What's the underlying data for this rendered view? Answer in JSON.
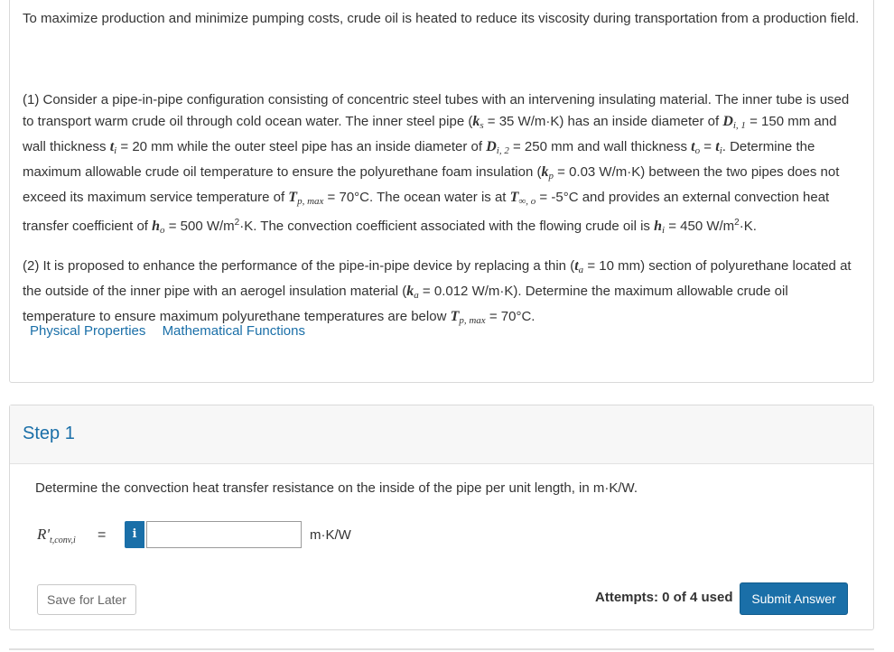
{
  "problem": {
    "intro": "To maximize production and minimize pumping costs, crude oil is heated to reduce its viscosity during transportation from a production field.",
    "part1": {
      "t1": "(1) Consider a pipe-in-pipe configuration consisting of concentric steel tubes with an intervening insulating material. The inner tube is used to transport warm crude oil through cold ocean water. The inner steel pipe (",
      "ks": "k",
      "ks_sub": "s",
      "t2": " = 35 W/m·K) has an inside diameter of ",
      "di1": "D",
      "di1_sub": "i, 1",
      "t3": " = 150 mm and wall thickness ",
      "ti": "t",
      "ti_sub": "i",
      "t4": " = 20 mm while the outer steel pipe has an inside diameter of ",
      "di2": "D",
      "di2_sub": "i, 2",
      "t5": " = 250 mm and wall thickness ",
      "to": "t",
      "to_sub": "o",
      "t6": " = ",
      "ti2": "t",
      "ti2_sub": "i",
      "t7": ". Determine the maximum allowable crude oil temperature to ensure the polyurethane foam insulation (",
      "kp": "k",
      "kp_sub": "p",
      "t8": " = 0.03 W/m·K) between the two pipes does not exceed its maximum service temperature of ",
      "tpmax": "T",
      "tpmax_sub": "p, max",
      "t9": " = 70°C. The ocean water is at ",
      "tinf": "T",
      "tinf_sub": "∞, o",
      "t10": " = -5°C and provides an external convection heat transfer coefficient of ",
      "ho": "h",
      "ho_sub": "o",
      "t11": " = 500 W/m",
      "t11_sup": "2",
      "t12": "·K. The convection coefficient associated with the flowing crude oil is ",
      "hi": "h",
      "hi_sub": "i",
      "t13": " = 450 W/m",
      "t13_sup": "2",
      "t14": "·K."
    },
    "part2": {
      "t1": "(2) It is proposed to enhance the performance of the pipe-in-pipe device by replacing a thin (",
      "ta": "t",
      "ta_sub": "a",
      "t2": " = 10 mm) section of polyurethane located at the outside of the inner pipe with an aerogel insulation material (",
      "ka": "k",
      "ka_sub": "a",
      "t3": " = 0.012 W/m·K). Determine the maximum allowable crude oil temperature to ensure maximum polyurethane temperatures are below ",
      "tp": "T",
      "tp_sub": "p, max",
      "t4": " = 70°C."
    },
    "links": [
      "Physical Properties",
      "Mathematical Functions"
    ]
  },
  "step": {
    "title": "Step 1",
    "question": "Determine the convection heat transfer resistance on the inside of the pipe per unit length, in m·K/W.",
    "symbol": "R'",
    "symbol_sub": "t,conv,i",
    "equals": "=",
    "info_label": "i",
    "answer_value": "",
    "unit": "m·K/W",
    "save_label": "Save for Later",
    "attempts": "Attempts: 0 of 4 used",
    "submit_label": "Submit Answer"
  },
  "colors": {
    "accent": "#1a6fa8",
    "header_bg": "#f7f7f7",
    "border": "#d9d9d9"
  }
}
